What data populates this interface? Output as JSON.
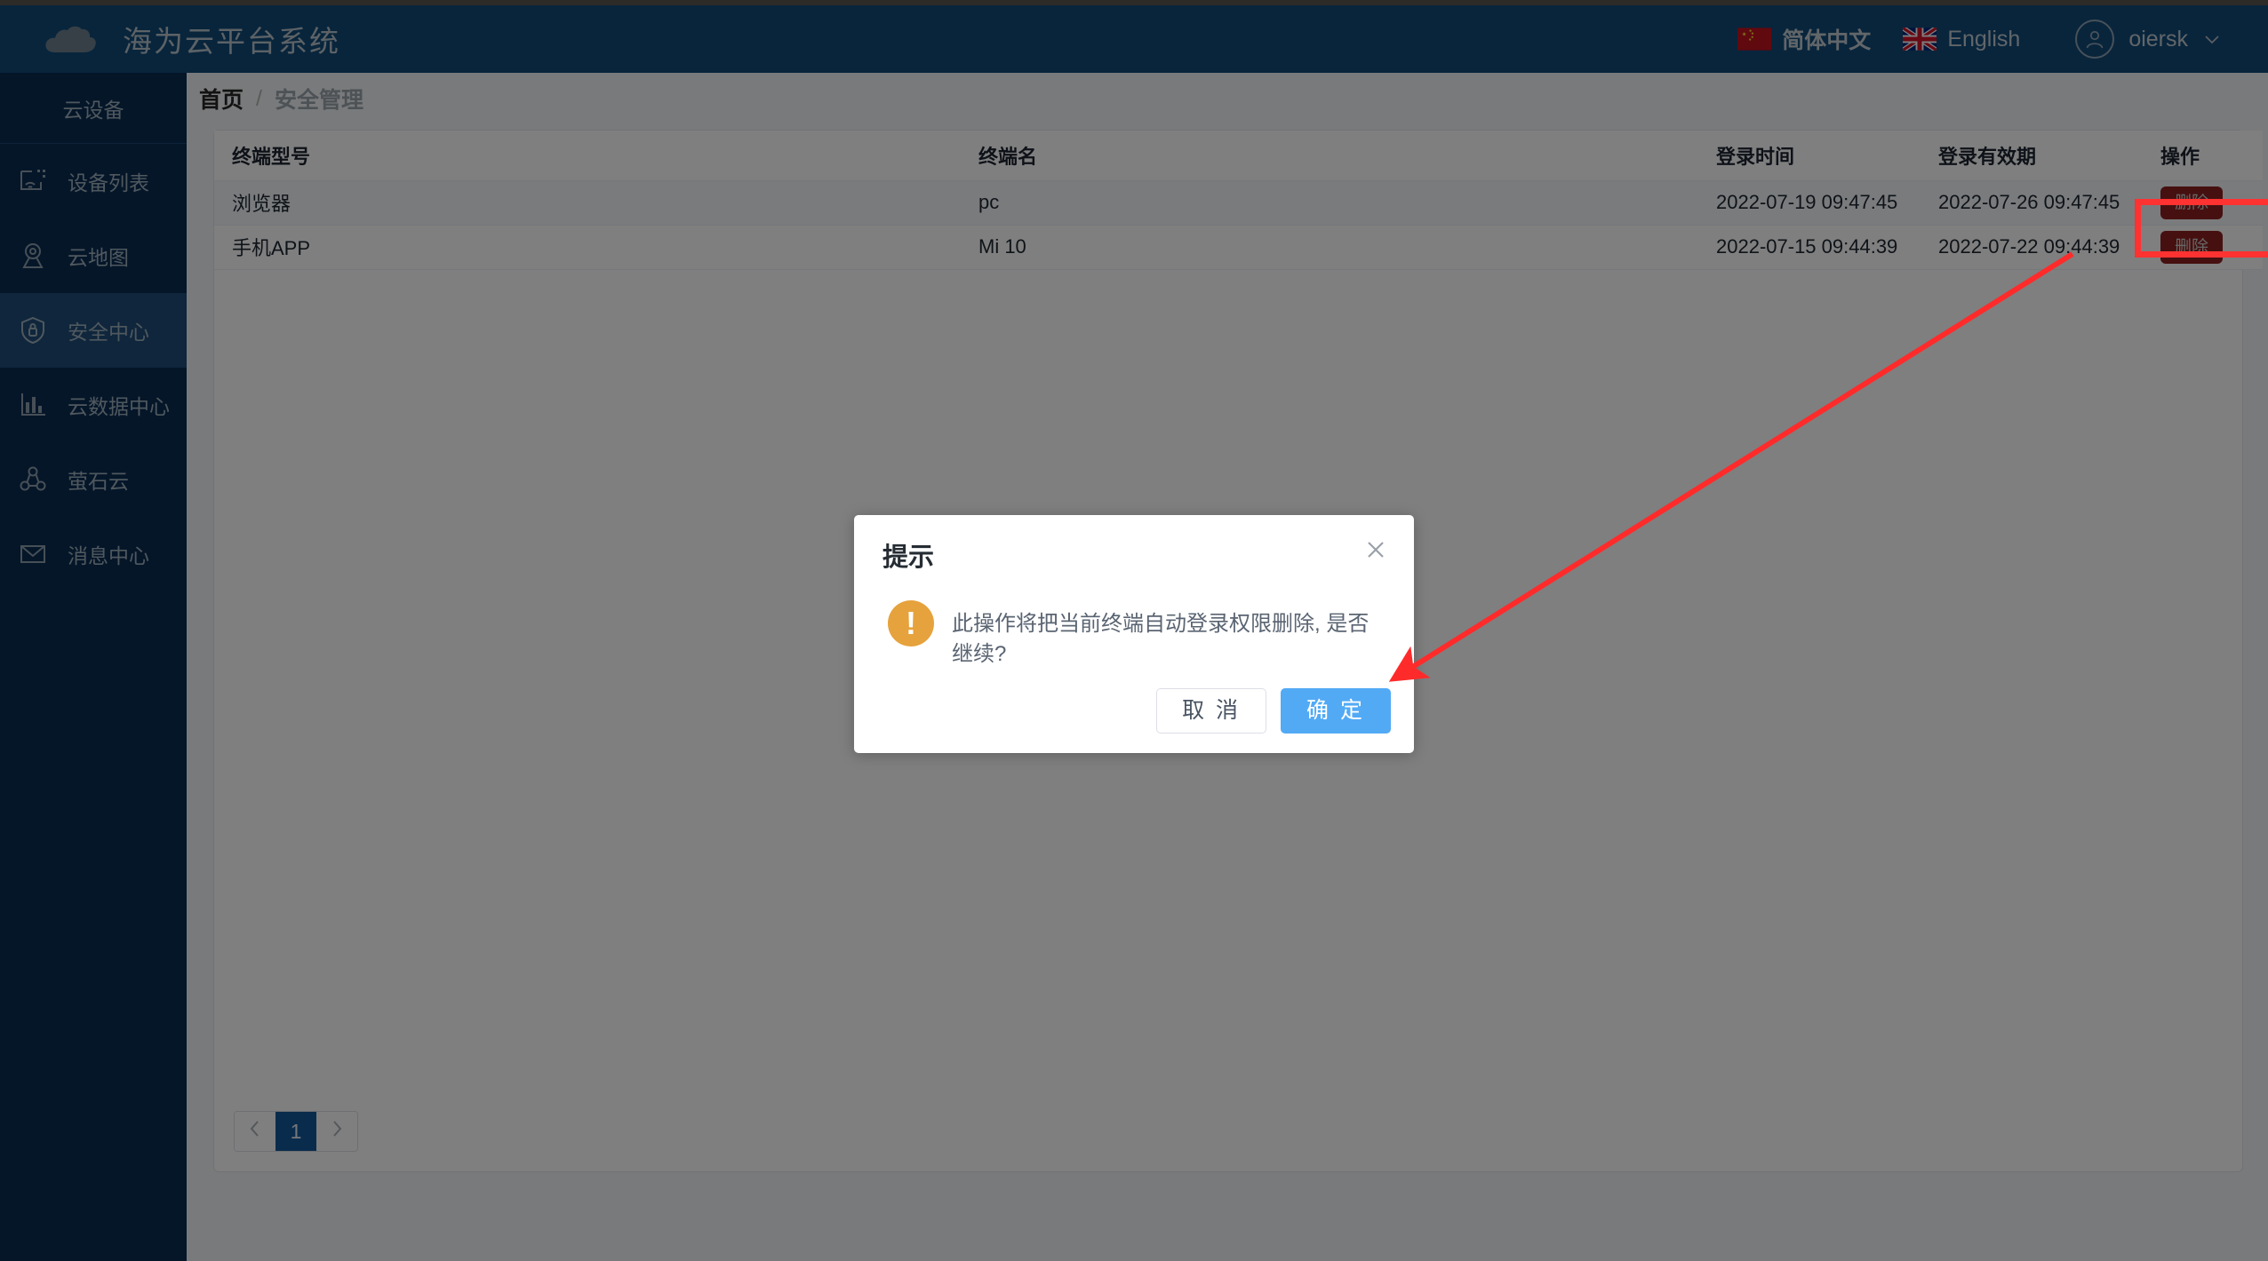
{
  "header": {
    "brand_title": "海为云平台系统",
    "cloud_icon": "cloud-icon",
    "languages": [
      {
        "label": "简体中文",
        "flag": "cn-flag-icon",
        "active": true
      },
      {
        "label": "English",
        "flag": "uk-flag-icon",
        "active": false
      }
    ],
    "user": {
      "name": "oiersk",
      "avatar_icon": "user-avatar-icon",
      "caret_icon": "chevron-down-icon"
    }
  },
  "sidebar": {
    "section_title": "云设备",
    "items": [
      {
        "label": "设备列表",
        "icon": "device-list-icon",
        "active": false
      },
      {
        "label": "云地图",
        "icon": "map-pin-icon",
        "active": false
      },
      {
        "label": "安全中心",
        "icon": "shield-lock-icon",
        "active": true
      },
      {
        "label": "云数据中心",
        "icon": "bar-chart-icon",
        "active": false
      },
      {
        "label": "萤石云",
        "icon": "share-nodes-icon",
        "active": false
      },
      {
        "label": "消息中心",
        "icon": "envelope-icon",
        "active": false
      }
    ]
  },
  "breadcrumb": {
    "home": "首页",
    "separator": "/",
    "current": "安全管理"
  },
  "table": {
    "columns": [
      {
        "key": "model",
        "label": "终端型号",
        "align": "left"
      },
      {
        "key": "name",
        "label": "终端名",
        "align": "left"
      },
      {
        "key": "login_time",
        "label": "登录时间",
        "align": "center"
      },
      {
        "key": "expiry",
        "label": "登录有效期",
        "align": "center"
      },
      {
        "key": "action",
        "label": "操作",
        "align": "center"
      }
    ],
    "rows": [
      {
        "model": "浏览器",
        "name": "pc",
        "login_time": "2022-07-19 09:47:45",
        "expiry": "2022-07-26 09:47:45",
        "action_label": "删除",
        "hovered": true
      },
      {
        "model": "手机APP",
        "name": "Mi 10",
        "login_time": "2022-07-15 09:44:39",
        "expiry": "2022-07-22 09:44:39",
        "action_label": "删除",
        "hovered": false
      }
    ]
  },
  "pagination": {
    "prev_icon": "chevron-left-icon",
    "next_icon": "chevron-right-icon",
    "pages": [
      "1"
    ],
    "current_page": "1"
  },
  "modal": {
    "title": "提示",
    "close_icon": "close-icon",
    "warn_icon": "warning-exclamation-icon",
    "warn_glyph": "!",
    "message": "此操作将把当前终端自动登录权限删除, 是否继续?",
    "cancel_label": "取 消",
    "confirm_label": "确 定"
  },
  "annotations": {
    "highlight_box_target": "delete-button-row-1",
    "arrow_target": "modal-confirm-button",
    "color": "#ff3232"
  },
  "colors": {
    "header_bg": "#114a78",
    "sidebar_bg": "#0a2c52",
    "sidebar_active": "#1f4c79",
    "delete_button": "#8c2020",
    "confirm_button": "#52aaf5",
    "warning": "#e6a23c",
    "pager_active": "#13599b",
    "annotation_red": "#ff3232"
  }
}
